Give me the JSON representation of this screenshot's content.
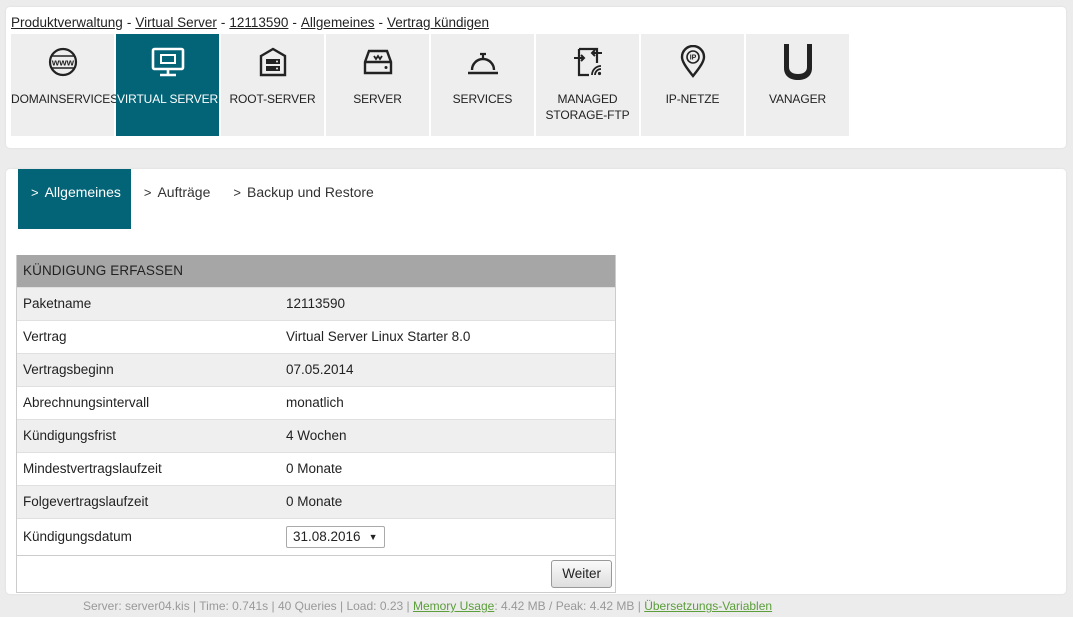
{
  "breadcrumb": [
    {
      "label": "Produktverwaltung"
    },
    {
      "label": "Virtual Server"
    },
    {
      "label": "12113590"
    },
    {
      "label": "Allgemeines"
    },
    {
      "label": "Vertrag kündigen"
    }
  ],
  "breadcrumb_sep": "-",
  "nav": [
    {
      "label": "DOMAINSERVICES",
      "icon": "globe-www-icon"
    },
    {
      "label": "VIRTUAL SERVER",
      "icon": "monitor-icon",
      "active": true
    },
    {
      "label": "ROOT-SERVER",
      "icon": "server-rack-icon"
    },
    {
      "label": "SERVER",
      "icon": "server-drive-icon"
    },
    {
      "label": "SERVICES",
      "icon": "service-bell-icon"
    },
    {
      "label": "MANAGED\nSTORAGE-FTP",
      "icon": "storage-ftp-icon"
    },
    {
      "label": "IP-NETZE",
      "icon": "ip-pin-icon"
    },
    {
      "label": "VANAGER",
      "icon": "vanager-logo-icon"
    }
  ],
  "subtabs": [
    {
      "label": "Allgemeines",
      "active": true
    },
    {
      "label": "Aufträge"
    },
    {
      "label": "Backup und Restore"
    }
  ],
  "form": {
    "title": "KÜNDIGUNG ERFASSEN",
    "rows": [
      {
        "key": "Paketname",
        "value": "12113590"
      },
      {
        "key": "Vertrag",
        "value": "Virtual Server Linux Starter 8.0"
      },
      {
        "key": "Vertragsbeginn",
        "value": "07.05.2014"
      },
      {
        "key": "Abrechnungsintervall",
        "value": "monatlich"
      },
      {
        "key": "Kündigungsfrist",
        "value": "4 Wochen"
      },
      {
        "key": "Mindestvertragslaufzeit",
        "value": "0 Monate"
      },
      {
        "key": "Folgevertragslaufzeit",
        "value": "0 Monate"
      }
    ],
    "date_label": "Kündigungsdatum",
    "date_value": "31.08.2016",
    "submit_label": "Weiter"
  },
  "status": {
    "prefix": "Server: server04.kis | Time: 0.741s | 40 Queries | Load: 0.23 |",
    "memory_link": "Memory Usage",
    "memory_text": ": 4.42 MB / Peak: 4.42 MB |",
    "translations_link": "Übersetzungs-Variablen"
  },
  "colors": {
    "accent": "#036377",
    "tile": "#eeeeee",
    "link_green": "#5b9e3a"
  }
}
